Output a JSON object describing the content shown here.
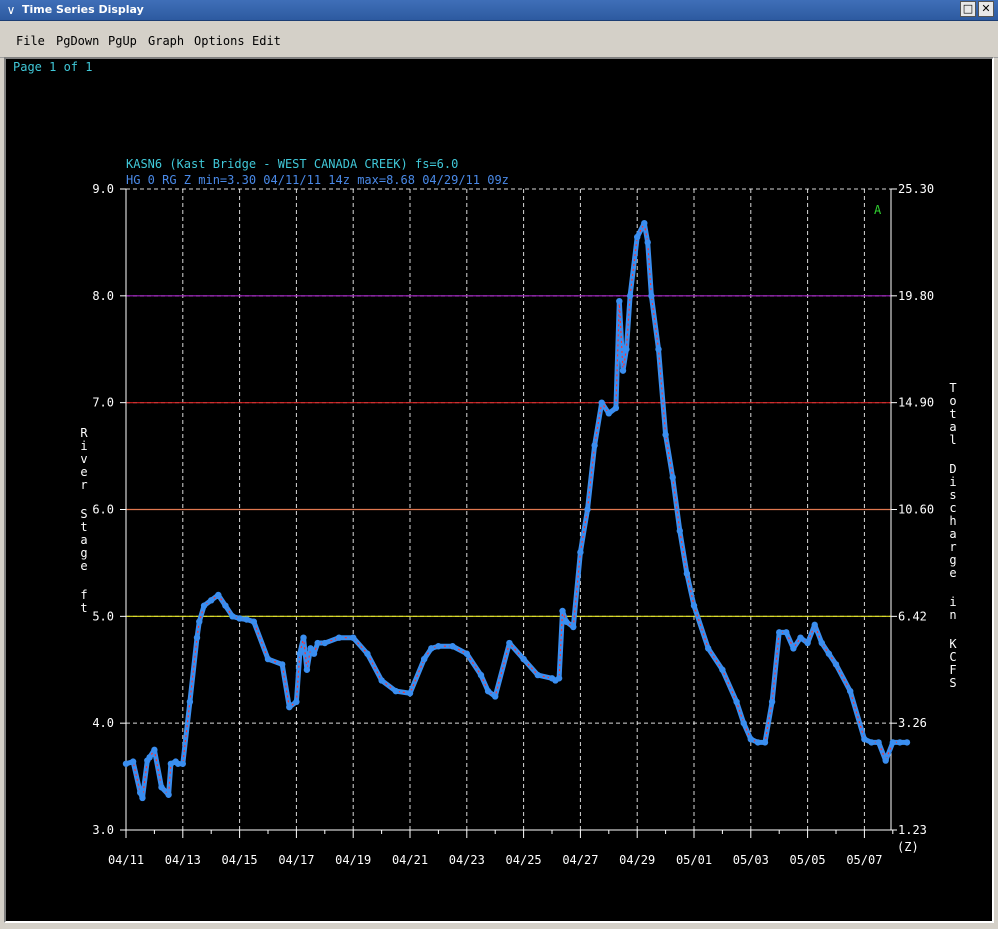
{
  "window": {
    "title": "Time Series Display",
    "icon": "chevron-down-icon"
  },
  "menu": [
    "File",
    "PgDown",
    "PgUp",
    "Graph",
    "Options",
    "Edit"
  ],
  "page_label": "Page 1 of 1",
  "station_line": "KASN6 (Kast Bridge - WEST CANADA CREEK) fs=6.0",
  "stats_line": "HG 0 RG Z min=3.30 04/11/11 14z max=8.68 04/29/11 09z",
  "marker": "A",
  "colors": {
    "background": "#000000",
    "series_points": "#3a8ef0",
    "series_line": "#ff3030",
    "text_cyan": "#40c8d8",
    "text_blue": "#4a8ae8",
    "marker": "#30d030",
    "major_flood": "#a020c0",
    "moderate_flood": "#d02020",
    "flood": "#e07850",
    "action": "#e0e020",
    "grid": "#ffffff"
  },
  "chart_data": {
    "type": "line",
    "title": "KASN6 (Kast Bridge - WEST CANADA CREEK) fs=6.0",
    "subtitle": "HG 0 RG Z min=3.30 04/11/11 14z max=8.68 04/29/11 09z",
    "ylabel": "River Stage ft",
    "ylabel_right": "Total Discharge in KCFS",
    "xlabel": "(Z)",
    "ylim": [
      3.0,
      9.0
    ],
    "y_ticks": [
      "3.0",
      "4.0",
      "5.0",
      "6.0",
      "7.0",
      "8.0",
      "9.0"
    ],
    "y_right_ticks": [
      "1.23",
      "3.26",
      "6.42",
      "10.60",
      "14.90",
      "19.80",
      "25.30"
    ],
    "x_ticks": [
      "04/11",
      "04/13",
      "04/15",
      "04/17",
      "04/19",
      "04/21",
      "04/23",
      "04/25",
      "04/27",
      "04/29",
      "05/01",
      "05/03",
      "05/05",
      "05/07"
    ],
    "xlim_days": [
      0,
      27.5
    ],
    "thresholds": [
      {
        "stage": 8.0,
        "color": "#a020c0"
      },
      {
        "stage": 7.0,
        "color": "#d02020"
      },
      {
        "stage": 6.0,
        "color": "#e07850"
      },
      {
        "stage": 5.0,
        "color": "#e0e020"
      }
    ],
    "grid": true,
    "series": [
      {
        "x": [
          "04/11",
          "04/11 06z",
          "04/11 12z",
          "04/11 14z",
          "04/11 18z",
          "04/11 20z",
          "04/12 00z",
          "04/12 06z",
          "04/12 12z",
          "04/12 14z",
          "04/12 18z",
          "04/12 20z",
          "04/13 00z",
          "04/13 06z",
          "04/13 12z",
          "04/13 14z",
          "04/13 18z",
          "04/14 00z",
          "04/14 06z",
          "04/14 12z",
          "04/14 18z",
          "04/15 00z",
          "04/15 06z",
          "04/15 12z",
          "04/16 00z",
          "04/16 12z",
          "04/16 18z",
          "04/17 00z",
          "04/17 03z",
          "04/17 06z",
          "04/17 09z",
          "04/17 12z",
          "04/17 15z",
          "04/17 18z",
          "04/18 00z",
          "04/18 12z",
          "04/19 00z",
          "04/19 12z",
          "04/20 00z",
          "04/20 12z",
          "04/21 00z",
          "04/21 12z",
          "04/21 18z",
          "04/22 00z",
          "04/22 12z",
          "04/23 00z",
          "04/23 12z",
          "04/23 18z",
          "04/24 00z",
          "04/24 12z",
          "04/25 00z",
          "04/25 12z",
          "04/26 00z",
          "04/26 03z",
          "04/26 06z",
          "04/26 09z",
          "04/26 12z",
          "04/26 18z",
          "04/27 00z",
          "04/27 06z",
          "04/27 12z",
          "04/27 18z",
          "04/28 00z",
          "04/28 06z",
          "04/28 09z",
          "04/28 12z",
          "04/28 15z",
          "04/28 18z",
          "04/29 00z",
          "04/29 06z",
          "04/29 09z",
          "04/29 12z",
          "04/29 18z",
          "04/30 00z",
          "04/30 06z",
          "04/30 12z",
          "04/30 18z",
          "05/01 00z",
          "05/01 12z",
          "05/02 00z",
          "05/02 12z",
          "05/02 18z",
          "05/03 00z",
          "05/03 06z",
          "05/03 12z",
          "05/03 18z",
          "05/04 00z",
          "05/04 06z",
          "05/04 12z",
          "05/04 18z",
          "05/05 00z",
          "05/05 06z",
          "05/05 12z",
          "05/05 18z",
          "05/06 00z",
          "05/06 12z",
          "05/07 00z",
          "05/07 06z",
          "05/07 12z",
          "05/07 18z",
          "05/08 00z",
          "05/08 06z",
          "05/08 12z"
        ],
        "days": [
          0,
          0.25,
          0.5,
          0.58,
          0.75,
          0.83,
          1,
          1.25,
          1.5,
          1.58,
          1.75,
          1.83,
          2,
          2.25,
          2.5,
          2.58,
          2.75,
          3,
          3.25,
          3.5,
          3.75,
          4,
          4.25,
          4.5,
          5,
          5.5,
          5.75,
          6,
          6.12,
          6.25,
          6.37,
          6.5,
          6.62,
          6.75,
          7,
          7.5,
          8,
          8.5,
          9,
          9.5,
          10,
          10.5,
          10.75,
          11,
          11.5,
          12,
          12.5,
          12.75,
          13,
          13.5,
          14,
          14.5,
          15,
          15.12,
          15.25,
          15.37,
          15.5,
          15.75,
          16,
          16.25,
          16.5,
          16.75,
          17,
          17.25,
          17.37,
          17.5,
          17.62,
          17.75,
          18,
          18.25,
          18.37,
          18.5,
          18.75,
          19,
          19.25,
          19.5,
          19.75,
          20,
          20.5,
          21,
          21.5,
          21.75,
          22,
          22.25,
          22.5,
          22.75,
          23,
          23.25,
          23.5,
          23.75,
          24,
          24.25,
          24.5,
          24.75,
          25,
          25.5,
          26,
          26.25,
          26.5,
          26.75,
          27,
          27.25,
          27.5
        ],
        "values": [
          3.62,
          3.64,
          3.35,
          3.3,
          3.65,
          3.68,
          3.75,
          3.4,
          3.33,
          3.62,
          3.64,
          3.62,
          3.62,
          4.2,
          4.8,
          4.95,
          5.1,
          5.15,
          5.2,
          5.1,
          5.0,
          4.98,
          4.97,
          4.95,
          4.6,
          4.55,
          4.15,
          4.2,
          4.65,
          4.8,
          4.5,
          4.7,
          4.65,
          4.75,
          4.75,
          4.8,
          4.8,
          4.65,
          4.4,
          4.3,
          4.28,
          4.6,
          4.7,
          4.72,
          4.72,
          4.65,
          4.45,
          4.3,
          4.25,
          4.75,
          4.6,
          4.45,
          4.42,
          4.4,
          4.42,
          5.05,
          4.95,
          4.9,
          5.6,
          6.0,
          6.6,
          7.0,
          6.9,
          6.95,
          7.95,
          7.3,
          7.5,
          8.0,
          8.55,
          8.68,
          8.5,
          8.0,
          7.5,
          6.7,
          6.3,
          5.8,
          5.4,
          5.1,
          4.7,
          4.5,
          4.2,
          4.0,
          3.85,
          3.82,
          3.82,
          4.2,
          4.85,
          4.85,
          4.7,
          4.8,
          4.75,
          4.92,
          4.75,
          4.65,
          4.55,
          4.3,
          3.85,
          3.82,
          3.82,
          3.65,
          3.82,
          3.82,
          3.82
        ]
      }
    ]
  }
}
